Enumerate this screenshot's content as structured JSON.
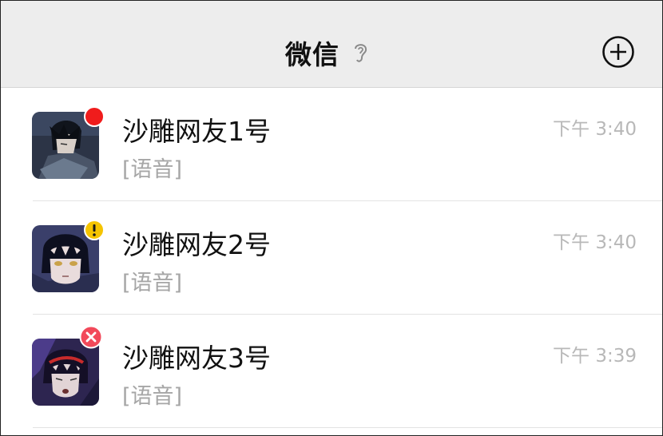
{
  "header": {
    "title": "微信",
    "right_icon": "add-circle-icon",
    "status_icon": "ear-icon"
  },
  "chats": [
    {
      "name": "沙雕网友1号",
      "preview": "[语音]",
      "time": "下午 3:40",
      "badge": "red-dot",
      "badge_color": "#f01c1c"
    },
    {
      "name": "沙雕网友2号",
      "preview": "[语音]",
      "time": "下午 3:40",
      "badge": "warning-icon",
      "badge_color": "#f5c400"
    },
    {
      "name": "沙雕网友3号",
      "preview": "[语音]",
      "time": "下午 3:39",
      "badge": "error-x-icon",
      "badge_color": "#f2495a"
    }
  ]
}
